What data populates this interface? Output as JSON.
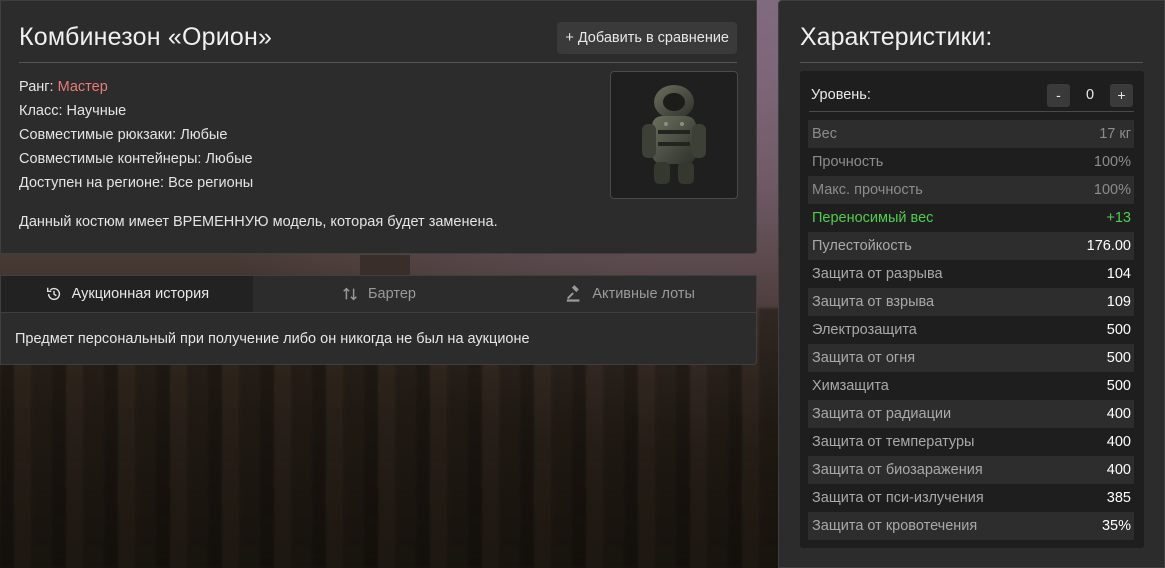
{
  "item": {
    "title": "Комбинезон «Орион»",
    "compare_button": "Добавить в сравнение",
    "rank_label": "Ранг:",
    "rank_value": "Мастер",
    "rank_color": "#e87a7a",
    "class_line": "Класс: Научные",
    "backpacks_line": "Совместимые рюкзаки: Любые",
    "containers_line": "Совместимые контейнеры: Любые",
    "region_line": "Доступен на регионе: Все регионы",
    "description": "Данный костюм имеет ВРЕМЕННУЮ модель, которая будет заменена."
  },
  "tabs": {
    "history": "Аукционная история",
    "barter": "Бартер",
    "lots": "Активные лоты",
    "active_tab": "history",
    "message": "Предмет персональный при получение либо он никогда не был на аукционе"
  },
  "stats": {
    "title": "Характеристики:",
    "level_label": "Уровень:",
    "minus": "-",
    "plus": "+",
    "level_value": "0",
    "rows": [
      {
        "name": "Вес",
        "value": "17 кг",
        "style": "dim"
      },
      {
        "name": "Прочность",
        "value": "100%",
        "style": "dim"
      },
      {
        "name": "Макс. прочность",
        "value": "100%",
        "style": "dim"
      },
      {
        "name": "Переносимый вес",
        "value": "+13",
        "style": "green"
      },
      {
        "name": "Пулестойкость",
        "value": "176.00",
        "style": "bright"
      },
      {
        "name": "Защита от разрыва",
        "value": "104",
        "style": "bright"
      },
      {
        "name": "Защита от взрыва",
        "value": "109",
        "style": "bright"
      },
      {
        "name": "Электрозащита",
        "value": "500",
        "style": "bright"
      },
      {
        "name": "Защита от огня",
        "value": "500",
        "style": "bright"
      },
      {
        "name": "Химзащита",
        "value": "500",
        "style": "bright"
      },
      {
        "name": "Защита от радиации",
        "value": "400",
        "style": "bright"
      },
      {
        "name": "Защита от температуры",
        "value": "400",
        "style": "bright"
      },
      {
        "name": "Защита от биозаражения",
        "value": "400",
        "style": "bright"
      },
      {
        "name": "Защита от пси-излучения",
        "value": "385",
        "style": "bright"
      },
      {
        "name": "Защита от кровотечения",
        "value": "35%",
        "style": "bright"
      }
    ]
  }
}
